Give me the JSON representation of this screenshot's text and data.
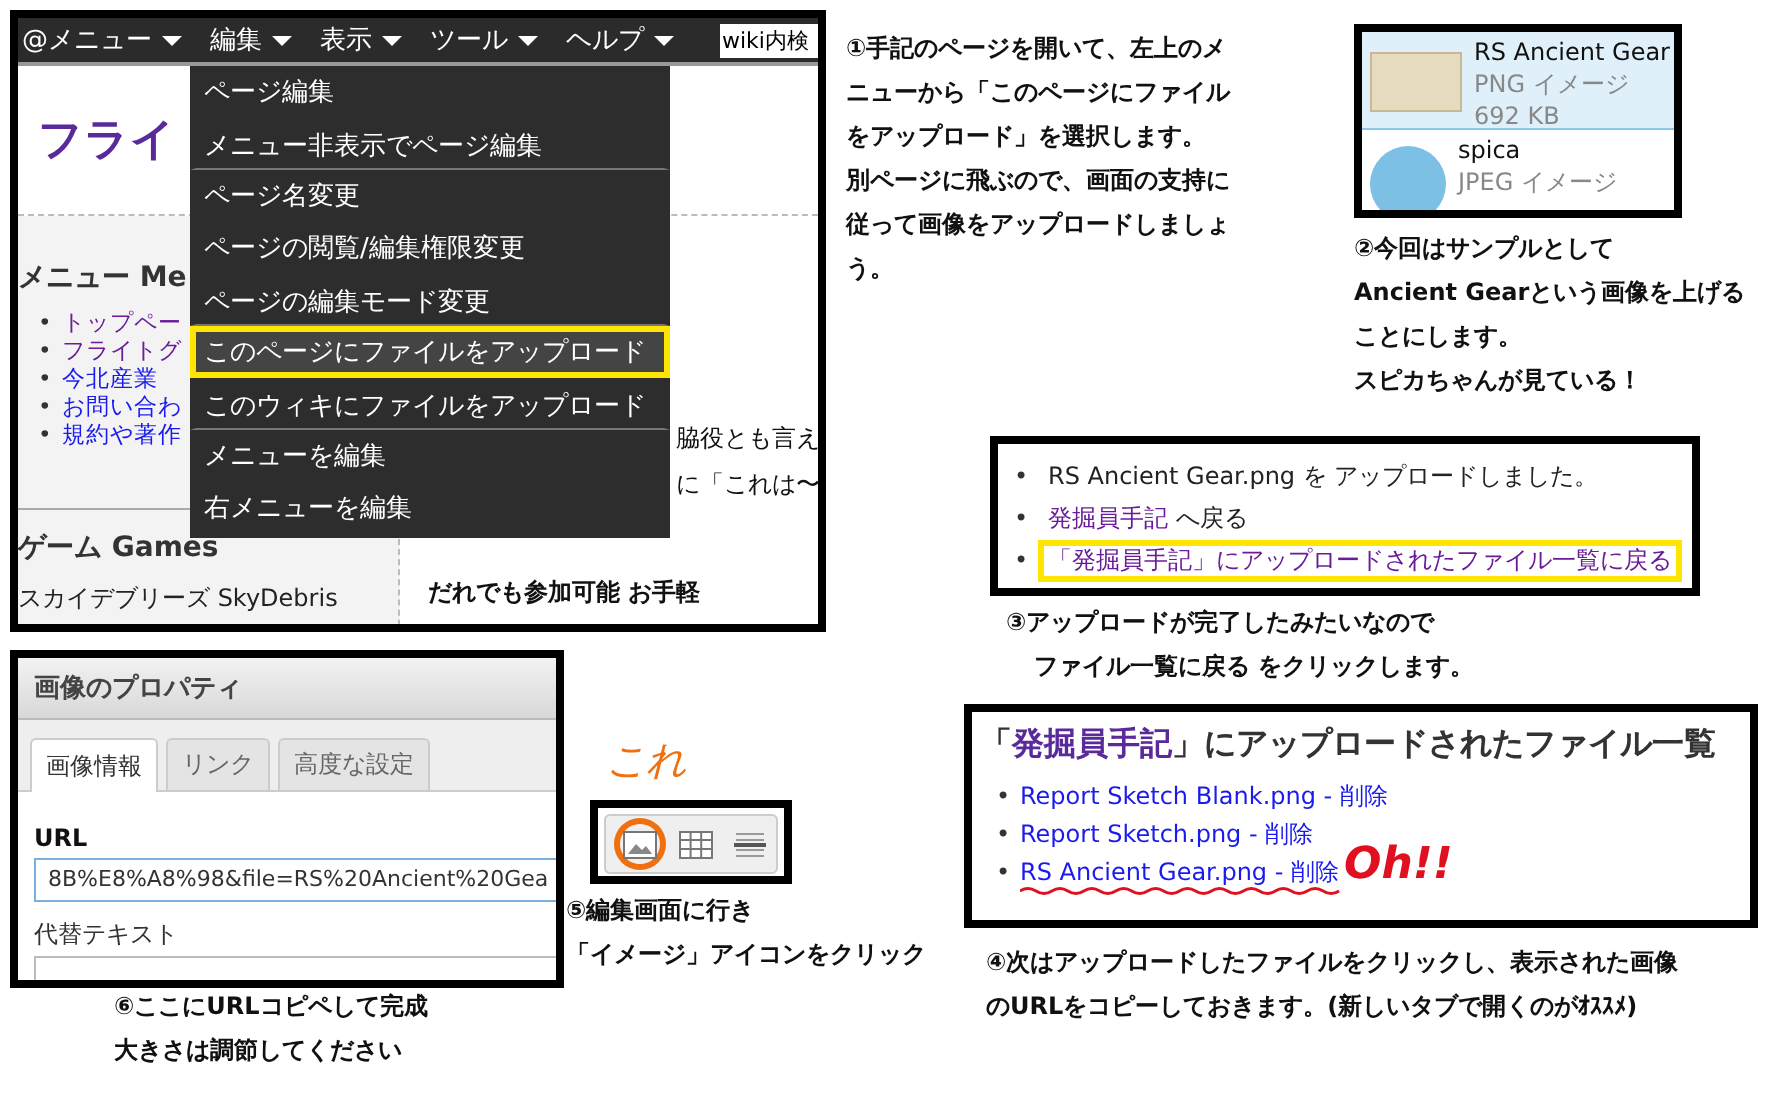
{
  "wiki_screenshot": {
    "menubar": [
      {
        "label": "@メニュー"
      },
      {
        "label": "編集"
      },
      {
        "label": "表示"
      },
      {
        "label": "ツール"
      },
      {
        "label": "ヘルプ"
      }
    ],
    "search_value": "wiki内検",
    "page_title": "フライ",
    "menu_heading": "メニュー Me",
    "menu_links": [
      {
        "marker": "•",
        "label": "トップペー",
        "visited": true
      },
      {
        "marker": "•",
        "label": "フライトグ",
        "visited": true
      },
      {
        "marker": "•",
        "label": "今北産業",
        "visited": false
      },
      {
        "marker": "•",
        "label": "お問い合わ",
        "visited": false
      },
      {
        "marker": "•",
        "label": "規約や著作",
        "visited": false
      }
    ],
    "games_heading": "ゲーム Games",
    "game_line": "スカイデブリーズ SkyDebris",
    "body_lines": [
      "脇役とも言え",
      "に「これは〜"
    ],
    "body_bold_line": "だれでも参加可能 お手軽",
    "dropdown": [
      {
        "label": "ページ編集",
        "highlighted": false,
        "separator_after": false
      },
      {
        "label": "メニュー非表示でページ編集",
        "highlighted": false,
        "separator_after": true
      },
      {
        "label": "ページ名変更",
        "highlighted": false,
        "separator_after": false
      },
      {
        "label": "ページの閲覧/編集権限変更",
        "highlighted": false,
        "separator_after": false
      },
      {
        "label": "ページの編集モード変更",
        "highlighted": false,
        "separator_after": true
      },
      {
        "label": "このページにファイルをアップロード",
        "highlighted": true,
        "separator_after": false
      },
      {
        "label": "このウィキにファイルをアップロード",
        "highlighted": false,
        "separator_after": true
      },
      {
        "label": "メニューを編集",
        "highlighted": false,
        "separator_after": false
      },
      {
        "label": "右メニューを編集",
        "highlighted": false,
        "separator_after": false
      }
    ]
  },
  "step1": [
    "①手記のページを開いて、左上のメ",
    "ニューから「このページにファイル",
    "をアップロード」を選択します。",
    "別ページに飛ぶので、画面の支持に",
    "従って画像をアップロードしましょ",
    "う。"
  ],
  "file_list": [
    {
      "kind": "drawing",
      "name": "RS Ancient Gear",
      "type": "PNG イメージ",
      "size": "692 KB",
      "selected": true
    },
    {
      "kind": "avatar",
      "name": "spica",
      "type": "JPEG イメージ",
      "selected": false
    }
  ],
  "step2": [
    "②今回はサンプルとして",
    "Ancient Gearという画像を上げる",
    "ことにします。",
    "スピカちゃんが見ている！"
  ],
  "upload_result": [
    {
      "marker": "•",
      "highlighted": false,
      "parts": [
        {
          "kind": "plain",
          "text": "RS Ancient Gear.png を アップロードしました。"
        }
      ]
    },
    {
      "marker": "•",
      "highlighted": false,
      "parts": [
        {
          "kind": "link",
          "text": "発掘員手記"
        },
        {
          "kind": "plain",
          "text": " へ戻る"
        }
      ]
    },
    {
      "marker": "•",
      "highlighted": true,
      "parts": [
        {
          "kind": "link",
          "text": "「発掘員手記」にアップロードされたファイル一覧に戻る"
        }
      ]
    }
  ],
  "step3": [
    "③アップロードが完了したみたいなので",
    "ファイル一覧に戻る をクリックします。"
  ],
  "image_dialog": {
    "title": "画像のプロパティ",
    "tabs": [
      {
        "label": "画像情報",
        "selected": true
      },
      {
        "label": "リンク",
        "selected": false
      },
      {
        "label": "高度な設定",
        "selected": false
      }
    ],
    "url_label": "URL",
    "url_value": "8B%E8%A8%98&file=RS%20Ancient%20Gea",
    "alt_label": "代替テキスト"
  },
  "step6": [
    "⑥ここにURLコピペして完成",
    "大きさは調節してください"
  ],
  "scribble_kore": "これ",
  "toolbar": [
    {
      "kind": "image",
      "circled": true
    },
    {
      "kind": "table",
      "circled": false
    },
    {
      "kind": "lines",
      "circled": false
    }
  ],
  "step5": [
    "⑤編集画面に行き",
    "「イメージ」アイコンをクリック"
  ],
  "file_page": {
    "heading": [
      {
        "kind": "plain",
        "text": "「"
      },
      {
        "kind": "link",
        "text": "発掘員手記"
      },
      {
        "kind": "plain",
        "text": "」にアップロードされたファイル一覧"
      }
    ],
    "files": [
      {
        "marker": "•",
        "name": "Report Sketch Blank.png",
        "separator": "-",
        "delete": "削除",
        "underlined": false
      },
      {
        "marker": "•",
        "name": "Report Sketch.png",
        "separator": "-",
        "delete": "削除",
        "underlined": false
      },
      {
        "marker": "•",
        "name": "RS Ancient Gear.png",
        "separator": "-",
        "delete": "削除",
        "underlined": true
      }
    ]
  },
  "scribble_oh": "Oh!!",
  "step4": [
    "④次はアップロードしたファイルをクリックし、表示された画像",
    "のURLをコピーしておきます。(新しいタブで開くのがｵｽｽﾒ)"
  ]
}
